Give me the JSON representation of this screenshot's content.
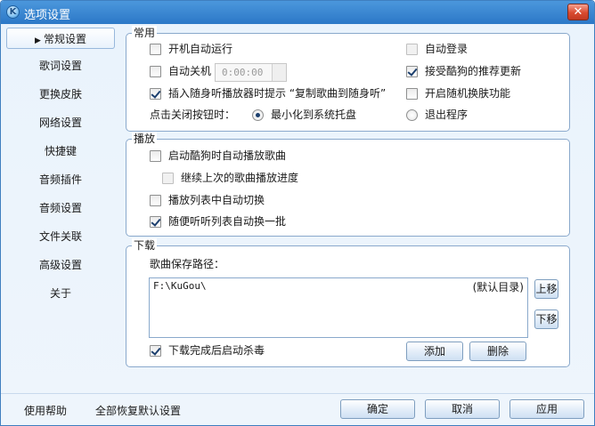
{
  "window": {
    "title": "选项设置",
    "close_glyph": "✕",
    "app_icon": "K"
  },
  "sidebar": {
    "items": [
      {
        "label": "常规设置",
        "active": true
      },
      {
        "label": "歌词设置"
      },
      {
        "label": "更换皮肤"
      },
      {
        "label": "网络设置"
      },
      {
        "label": "快捷键"
      },
      {
        "label": "音频插件"
      },
      {
        "label": "音频设置"
      },
      {
        "label": "文件关联"
      },
      {
        "label": "高级设置"
      },
      {
        "label": "关于"
      }
    ]
  },
  "general": {
    "legend": "常用",
    "autostart": {
      "label": "开机自动运行",
      "checked": false
    },
    "autologin": {
      "label": "自动登录",
      "checked": false,
      "disabled": true
    },
    "autoshutdown": {
      "label": "自动关机",
      "checked": false
    },
    "shutdown_time": "0:00:00",
    "accept_updates": {
      "label": "接受酷狗的推荐更新",
      "checked": true
    },
    "prompt_copy": {
      "label": "插入随身听播放器时提示 “复制歌曲到随身听”",
      "checked": true
    },
    "random_skin": {
      "label": "开启随机换肤功能",
      "checked": false
    },
    "close_button_label": "点击关闭按钮时：",
    "close_minimize": {
      "label": "最小化到系统托盘",
      "checked": true
    },
    "close_exit": {
      "label": "退出程序",
      "checked": false
    }
  },
  "playback": {
    "legend": "播放",
    "autoplay": {
      "label": "启动酷狗时自动播放歌曲",
      "checked": false
    },
    "resume": {
      "label": "继续上次的歌曲播放进度",
      "checked": false
    },
    "auto_switch": {
      "label": "播放列表中自动切换",
      "checked": false
    },
    "random_batch": {
      "label": "随便听听列表自动换一批",
      "checked": true
    }
  },
  "download": {
    "legend": "下载",
    "path_label": "歌曲保存路径：",
    "path_value": "F:\\KuGou\\",
    "path_default": "(默认目录)",
    "move_up": "上移",
    "move_down": "下移",
    "antivirus": {
      "label": "下载完成后启动杀毒",
      "checked": true
    },
    "add": "添加",
    "delete": "删除"
  },
  "footer": {
    "help": "使用帮助",
    "restore_defaults": "全部恢复默认设置",
    "ok": "确定",
    "cancel": "取消",
    "apply": "应用"
  }
}
